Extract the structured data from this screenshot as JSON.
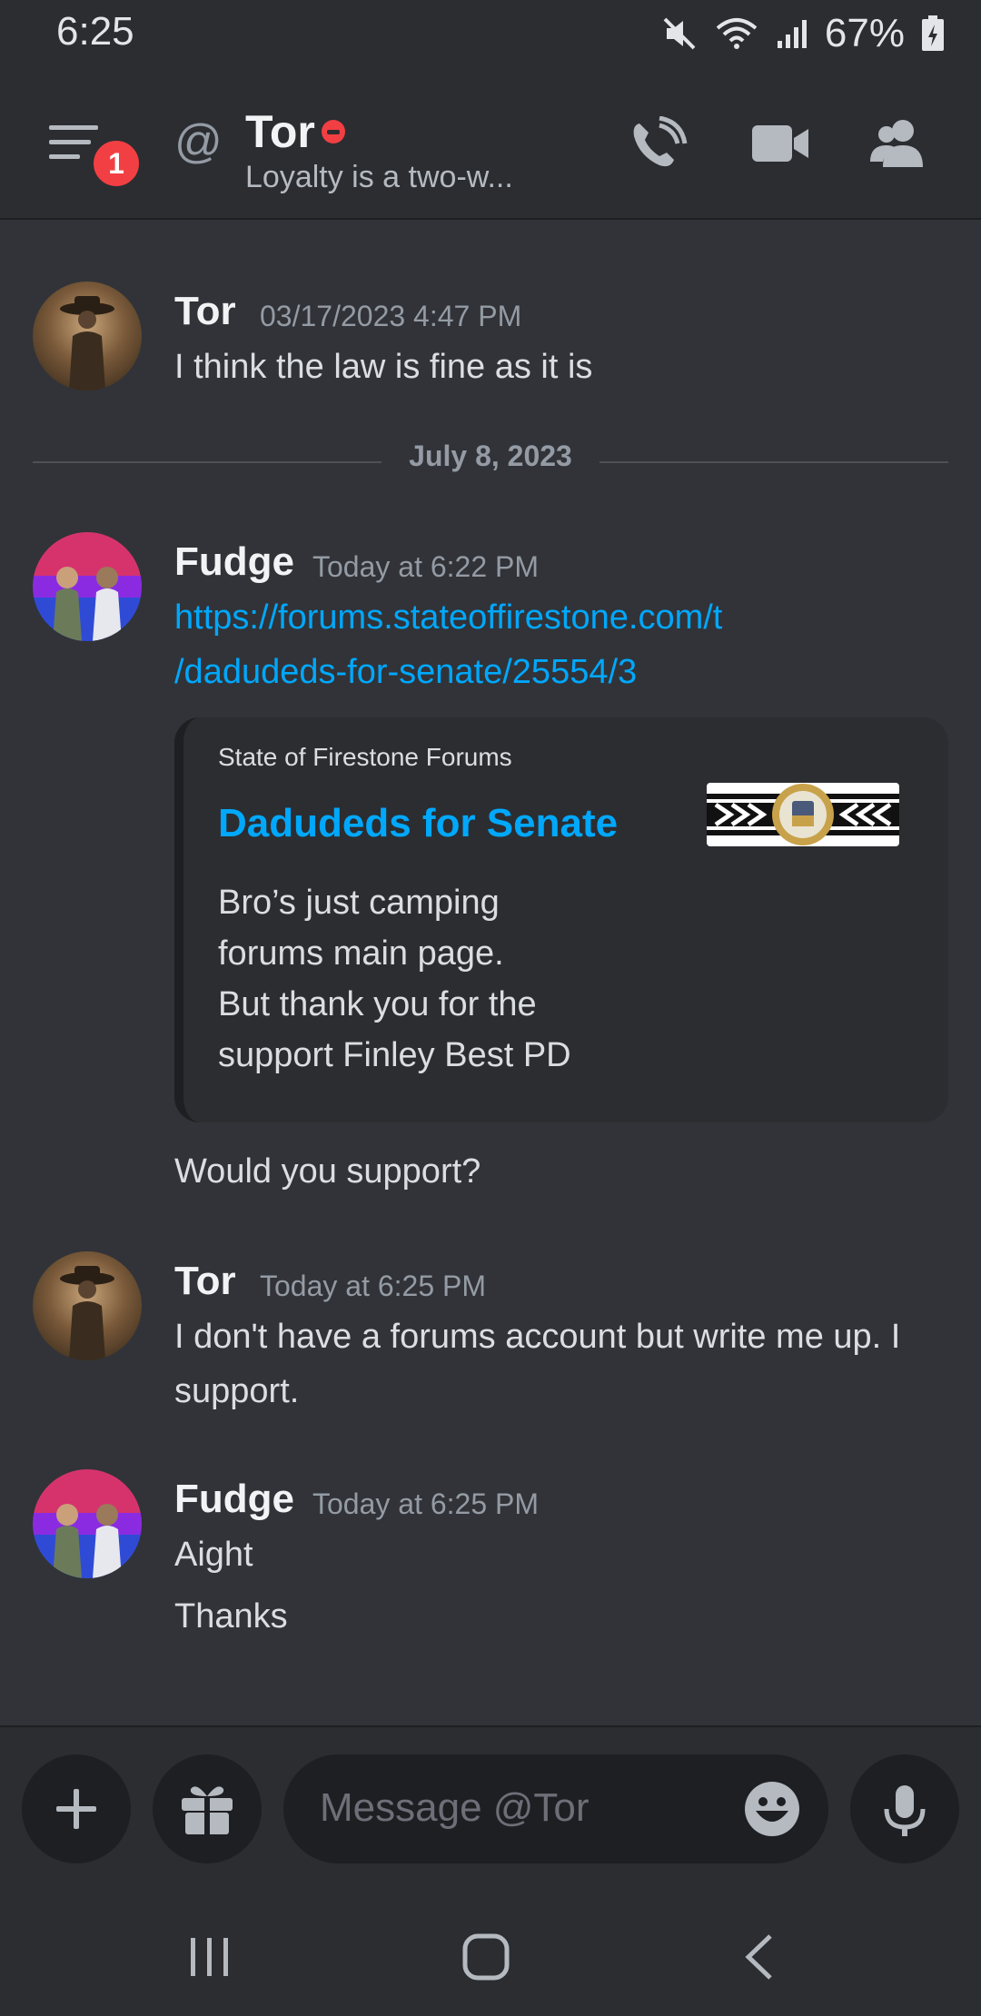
{
  "status_bar": {
    "time": "6:25",
    "battery": "67%"
  },
  "header": {
    "name": "Tor",
    "status": "Loyalty is a two-w...",
    "badge": "1",
    "at": "@"
  },
  "messages": [
    {
      "author": "Tor",
      "time": "03/17/2023 4:47 PM",
      "lines": [
        "I think the law is fine as it is"
      ]
    },
    {
      "author": "Fudge",
      "time": "Today at 6:22 PM",
      "link_line1": "https://forums.stateoffirestone.com/t",
      "link_line2": "/dadudeds-for-senate/25554/3",
      "followup": "Would you support?"
    },
    {
      "author": "Tor",
      "time": "Today at 6:25 PM",
      "line1": "I don't have a forums account but write me up. I",
      "line2": "support."
    },
    {
      "author": "Fudge",
      "time": "Today at 6:25 PM",
      "line1": "Aight",
      "line2": "Thanks"
    }
  ],
  "divider": {
    "date": "July 8, 2023"
  },
  "embed": {
    "provider": "State of Firestone Forums",
    "title": "Dadudeds for Senate",
    "desc_lines": [
      "Bro’s just camping",
      "forums main page.",
      "But thank you for the",
      "support Finley  Best PD"
    ]
  },
  "input": {
    "placeholder": "Message @Tor"
  },
  "colors": {
    "background": "#313338",
    "link": "#00a8fc",
    "dnd": "#f23f43"
  }
}
